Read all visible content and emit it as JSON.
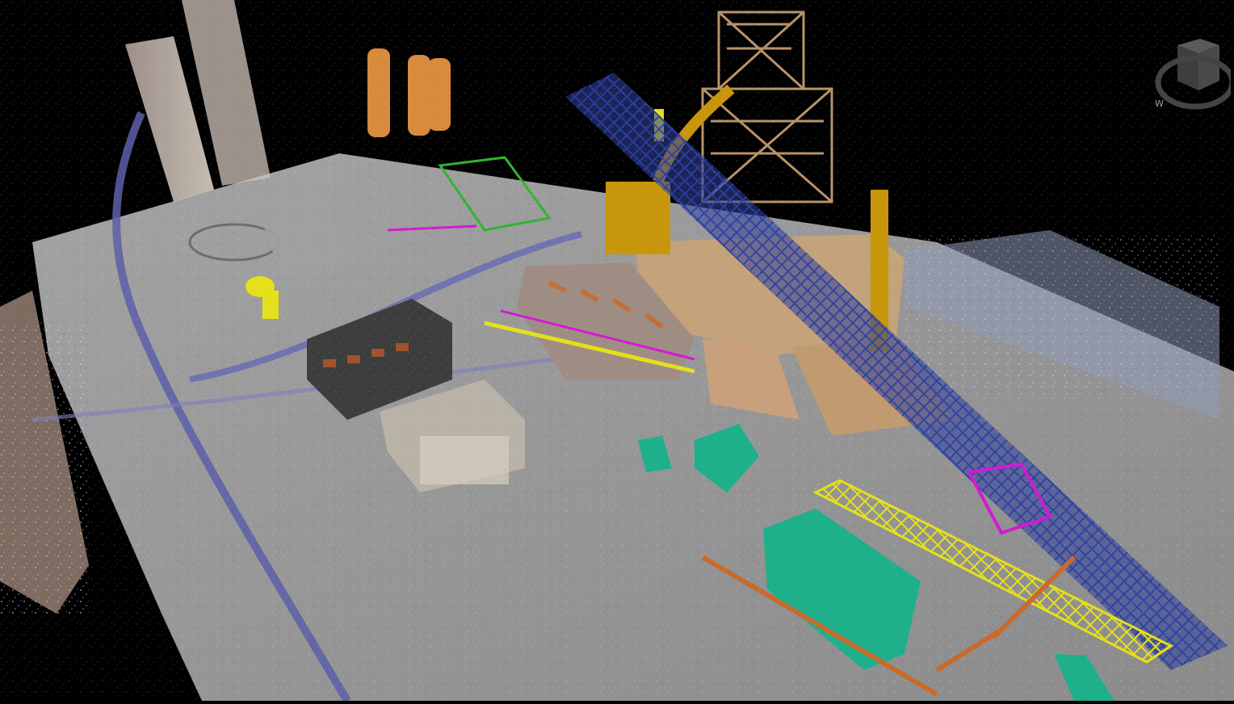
{
  "viewcube": {
    "compass_label": "W",
    "icon": "view-cube-icon"
  },
  "colors": {
    "background": "#000000",
    "ground": "#9a9a9a",
    "pipe_blue": "#3b4fa8",
    "structure_brown": "#c7a07a",
    "equipment_gold": "#c8960a",
    "teal": "#1db08a",
    "yellow": "#e6e01a",
    "magenta": "#d21ad2",
    "green": "#2fb52f",
    "dark_building": "#3d3d3d",
    "orange_pipe": "#c86a2a"
  }
}
